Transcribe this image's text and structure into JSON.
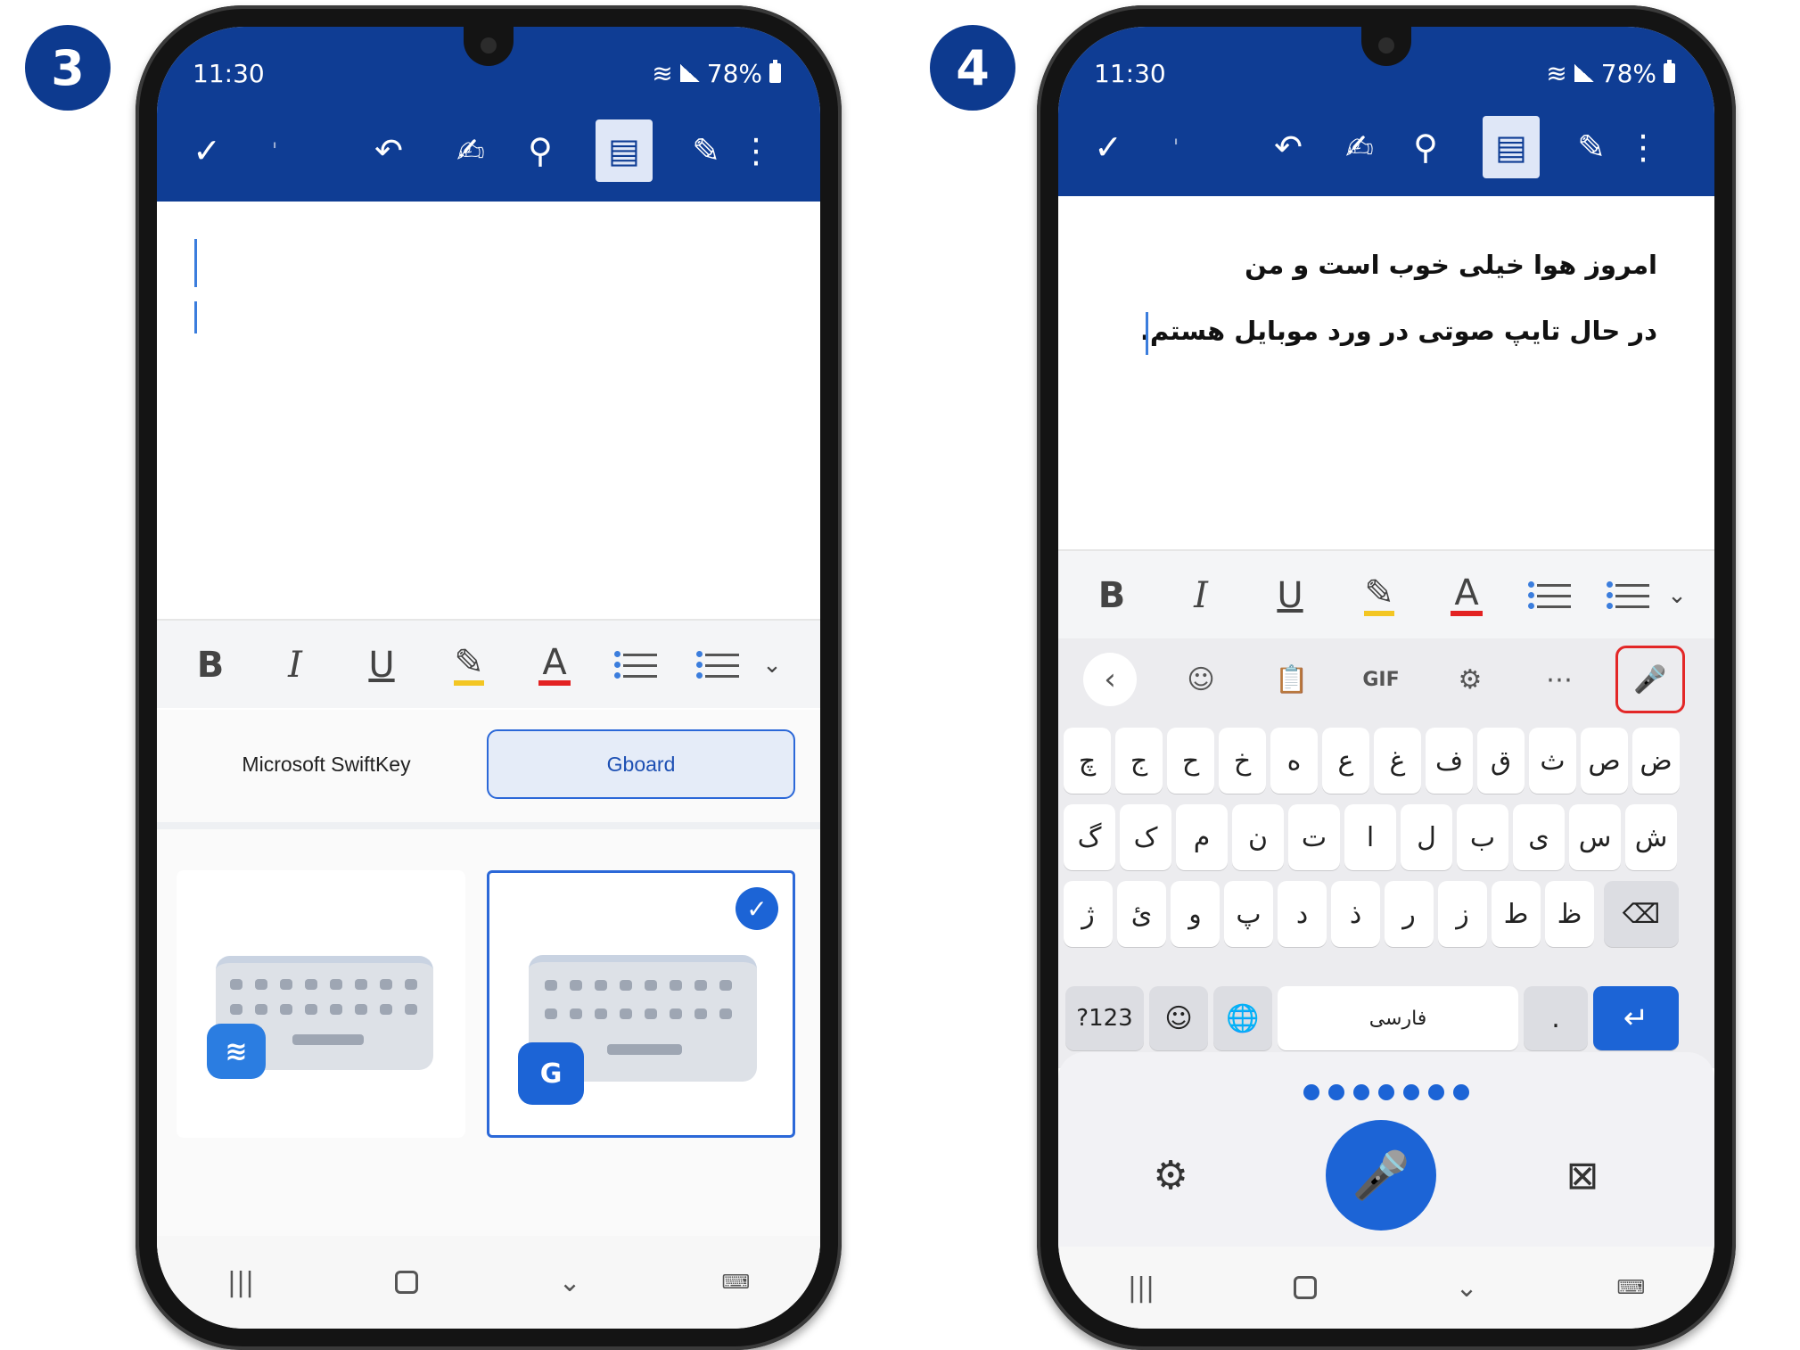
{
  "steps": [
    "3",
    "4"
  ],
  "colors": {
    "appbar": "#0f3d94",
    "accent": "#1c64d6",
    "mic_highlight": "#e32727",
    "highlighter": "#f3c623",
    "font_color": "#e32222"
  },
  "status_bar": {
    "time": "11:30",
    "battery": "78%",
    "icons": [
      "wifi-icon",
      "signal-icon",
      "battery-icon"
    ]
  },
  "toolbar_icons": [
    "check-icon",
    "undo-icon",
    "ink-pen-icon",
    "search-icon",
    "document-view-icon",
    "draw-icon",
    "more-icon"
  ],
  "format_bar": {
    "bold": "B",
    "italic": "I",
    "underline": "U",
    "font_color": "A",
    "icons": [
      "highlighter-icon",
      "bullet-list-icon",
      "numbered-list-icon",
      "chevron-down-icon"
    ]
  },
  "left_phone": {
    "keyboard_picker": {
      "options": [
        {
          "label": "Microsoft SwiftKey",
          "selected": false
        },
        {
          "label": "Gboard",
          "selected": true
        }
      ],
      "gboard_icon_letter": "G"
    }
  },
  "right_phone": {
    "document": {
      "lines": [
        "امروز هوا خیلی خوب است و من",
        "در حال تایپ صوتی در ورد موبایل هستم."
      ]
    },
    "suggestion_bar": {
      "gif_label": "GIF",
      "icons": [
        "back-icon",
        "emoji-icon",
        "clipboard-icon",
        "settings-icon",
        "more-icon",
        "microphone-icon"
      ]
    },
    "keyboard": {
      "row1": [
        "ض",
        "ص",
        "ث",
        "ق",
        "ف",
        "غ",
        "ع",
        "ه",
        "خ",
        "ح",
        "ج",
        "چ"
      ],
      "row2": [
        "ش",
        "س",
        "ی",
        "ب",
        "ل",
        "ا",
        "ت",
        "ن",
        "م",
        "ک",
        "گ"
      ],
      "row3": [
        "ظ",
        "ط",
        "ز",
        "ر",
        "ذ",
        "د",
        "پ",
        "و",
        "ئ",
        "ژ"
      ],
      "row4": {
        "symbols": "?123",
        "space": "فارسی",
        "period": "."
      }
    },
    "voice_panel": {
      "listening_dots": 7,
      "icons": [
        "settings-icon",
        "microphone-icon",
        "close-icon"
      ]
    }
  }
}
